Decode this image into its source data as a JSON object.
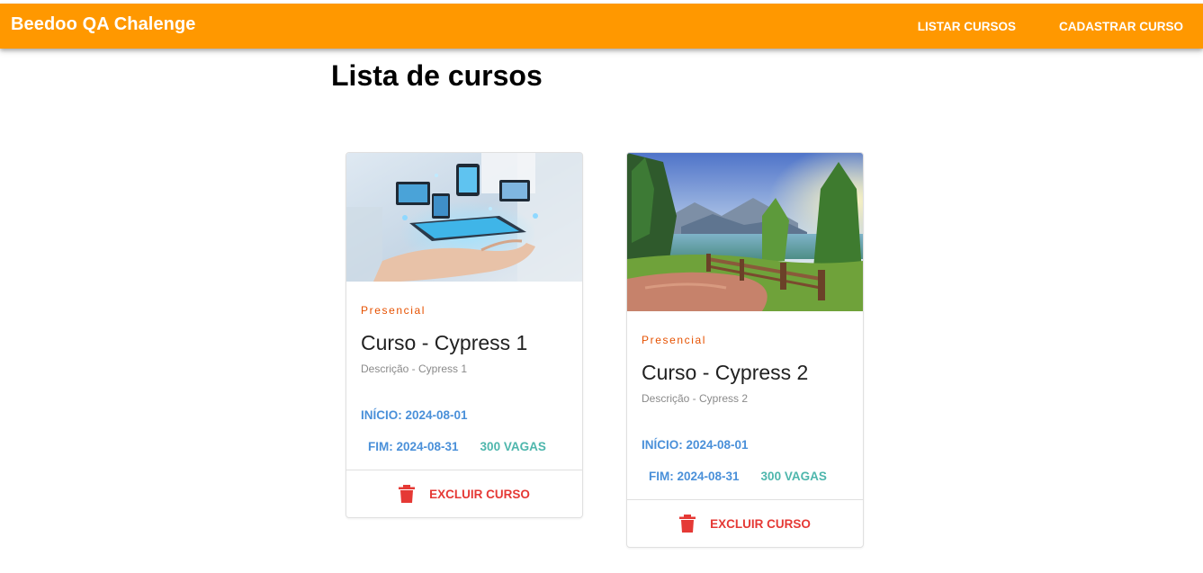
{
  "header": {
    "brand": "Beedoo QA Chalenge",
    "nav": [
      "LISTAR CURSOS",
      "CADASTRAR CURSO"
    ],
    "accent_color": "#ff9800"
  },
  "page": {
    "title": "Lista de cursos"
  },
  "courses": [
    {
      "image_icon": "technology-devices-photo",
      "modality": "Presencial",
      "title": "Curso - Cypress 1",
      "description": "Descrição - Cypress 1",
      "start": "INÍCIO: 2024-08-01",
      "end": "FIM: 2024-08-31",
      "seats": "300 VAGAS",
      "delete_label": "EXCLUIR CURSO"
    },
    {
      "image_icon": "mountain-lake-landscape-photo",
      "modality": "Presencial",
      "title": "Curso - Cypress 2",
      "description": "Descrição - Cypress 2",
      "start": "INÍCIO: 2024-08-01",
      "end": "FIM: 2024-08-31",
      "seats": "300 VAGAS",
      "delete_label": "EXCLUIR CURSO"
    }
  ],
  "colors": {
    "modality": "#e65100",
    "dates": "#4a90d9",
    "seats": "#4db6ac",
    "delete": "#e53935"
  }
}
